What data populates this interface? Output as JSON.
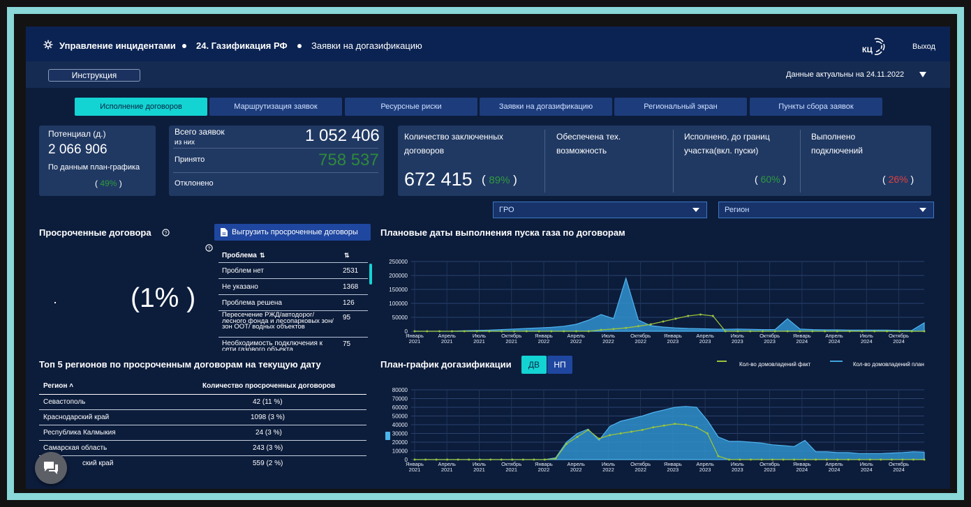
{
  "breadcrumb": {
    "item1": "Управление инцидентами",
    "item2": "24. Газификация РФ",
    "item3": "Заявки на догазификацию"
  },
  "header": {
    "logo_text": "КЦ",
    "exit_label": "Выход"
  },
  "subbar": {
    "instruction_label": "Инструкция",
    "data_actual": "Данные актуальны на 24.11.2022"
  },
  "tabs": [
    "Исполнение договоров",
    "Маршрутизация заявок",
    "Ресурсные риски",
    "Заявки на догазификацию",
    "Региональный экран",
    "Пункты сбора заявок"
  ],
  "kpi": {
    "potential": {
      "label": "Потенциал (д.)",
      "value": "2 066 906",
      "sub": "По данным план-графика",
      "pct": "49%"
    },
    "total": {
      "label": "Всего заявок",
      "sub": "из них",
      "value": "1 052 406",
      "accepted_label": "Принято",
      "accepted": "758 537",
      "rejected_label": "Отклонено"
    },
    "contracts": {
      "label": "Количество заключенных договоров",
      "value": "672 415",
      "pct": "89%"
    },
    "tech": {
      "label": "Обеспечена тех. возможность"
    },
    "done": {
      "label": "Исполнено, до границ участка(вкл. пуски)",
      "pct": "60%"
    },
    "connected": {
      "label": "Выполнено подключений",
      "pct": "26%"
    }
  },
  "filters": {
    "gro": "ГРО",
    "region": "Регион"
  },
  "overdue": {
    "title": "Просроченные договора",
    "export_label": "Выгрузить просроченные договоры",
    "big_pct": "(1% )",
    "table_header": "Проблема",
    "rows": [
      {
        "problem": "Проблем нет",
        "value": "2531"
      },
      {
        "problem": "Не указано",
        "value": "1368"
      },
      {
        "problem": "Проблема решена",
        "value": "126"
      },
      {
        "problem": "Пересечение РЖД/автодорог/ лесного фонда и лесопарковых зон/зон ООТ/ водных объектов",
        "value": "95"
      },
      {
        "problem": "Необходимость подключения к сети газового объекта",
        "value": "75"
      }
    ]
  },
  "top5": {
    "title": "Топ 5 регионов по просроченным договорам на текущую дату",
    "col1": "Регион",
    "col2": "Количество просроченных договоров",
    "rows": [
      {
        "region": "Севастополь",
        "value": "42 (11 %)"
      },
      {
        "region": "Краснодарский край",
        "value": "1098 (3 %)"
      },
      {
        "region": "Республика Калмыкия",
        "value": "24 (3 %)"
      },
      {
        "region": "Самарская область",
        "value": "243 (3 %)"
      },
      {
        "region": "ский край",
        "value": "559 (2 %)"
      }
    ]
  },
  "chart1_title": "Плановые даты выполнения пуска газа по договорам",
  "chart2": {
    "title": "План-график догазификации",
    "btn_dv": "ДВ",
    "btn_np": "НП",
    "legend_fact": "Кол-во домовладений факт",
    "legend_plan": "Кол-во домовладений план"
  },
  "colors": {
    "accent": "#14d3d3",
    "plan": "#3fa4dc",
    "fact": "#9ac43c",
    "green": "#2e9a3e",
    "red": "#e04040"
  },
  "chart_data": [
    {
      "type": "area",
      "title": "Плановые даты выполнения пуска газа по договорам",
      "x_labels": [
        "Январь 2021",
        "Апрель 2021",
        "Июль 2021",
        "Октябрь 2021",
        "Январь 2022",
        "Апрель 2022",
        "Июль 2022",
        "Октябрь 2022",
        "Январь 2023",
        "Апрель 2023",
        "Июль 2023",
        "Октябрь 2023",
        "Январь 2024",
        "Апрель 2024",
        "Июль 2024",
        "Октябрь 2024"
      ],
      "ylim": [
        0,
        250000
      ],
      "yticks": [
        0,
        50000,
        100000,
        150000,
        200000,
        250000
      ],
      "series": [
        {
          "values": [
            0,
            0,
            0,
            500,
            2000,
            3000,
            4000,
            6000,
            8000,
            10000,
            12000,
            14000,
            18000,
            25000,
            40000,
            60000,
            45000,
            190000,
            40000,
            20000,
            15000,
            12000,
            10000,
            9000,
            8000,
            7000,
            8000,
            7000,
            6000,
            6000,
            45000,
            8000,
            6000,
            5000,
            5000,
            4000,
            4000,
            4000,
            4000,
            3000,
            3000,
            30000
          ]
        },
        {
          "values": [
            0,
            0,
            0,
            0,
            0,
            0,
            0,
            0,
            0,
            0,
            0,
            0,
            0,
            0,
            0,
            5000,
            8000,
            12000,
            18000,
            25000,
            35000,
            45000,
            55000,
            60000,
            55000,
            0,
            0,
            0,
            0,
            0,
            0,
            0,
            0,
            0,
            0,
            0,
            0,
            0,
            0,
            0,
            0,
            0
          ]
        }
      ]
    },
    {
      "type": "area",
      "title": "План-график догазификации",
      "x_labels": [
        "Январь 2021",
        "Апрель 2021",
        "Июль 2021",
        "Октябрь 2021",
        "Январь 2022",
        "Апрель 2022",
        "Июль 2022",
        "Октябрь 2022",
        "Январь 2023",
        "Апрель 2023",
        "Июль 2023",
        "Октябрь 2023",
        "Январь 2024",
        "Апрель 2024",
        "Июль 2024",
        "Октябрь 2024"
      ],
      "ylim": [
        0,
        80000
      ],
      "yticks": [
        0,
        10000,
        20000,
        30000,
        40000,
        50000,
        60000,
        70000,
        80000
      ],
      "series": [
        {
          "name": "Кол-во домовладений план",
          "values": [
            0,
            0,
            0,
            0,
            0,
            0,
            0,
            0,
            0,
            0,
            0,
            0,
            0,
            2000,
            20000,
            30000,
            35000,
            22000,
            38000,
            44000,
            47000,
            50000,
            54000,
            57000,
            60000,
            61000,
            60000,
            45000,
            26000,
            21000,
            21000,
            20000,
            19000,
            17000,
            16000,
            15000,
            22000,
            9000,
            9000,
            8000,
            8000,
            7000,
            7000,
            7000,
            7500,
            8000,
            9000,
            8500
          ]
        },
        {
          "name": "Кол-во домовладений факт",
          "values": [
            0,
            0,
            0,
            0,
            0,
            0,
            0,
            0,
            0,
            0,
            0,
            0,
            0,
            1000,
            18000,
            26000,
            34000,
            24000,
            28000,
            30000,
            32000,
            34000,
            37000,
            39000,
            41000,
            40000,
            37000,
            30000,
            4000,
            0,
            0,
            0,
            0,
            0,
            0,
            0,
            0,
            0,
            0,
            0,
            0,
            0,
            0,
            0,
            0,
            0,
            0,
            0
          ]
        }
      ]
    }
  ]
}
